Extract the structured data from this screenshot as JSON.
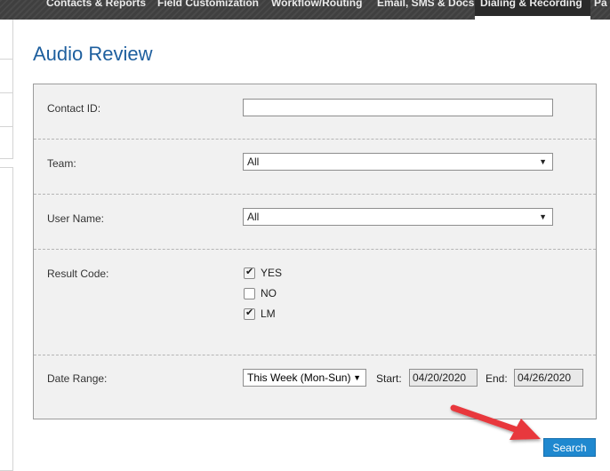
{
  "nav": {
    "tabs": [
      {
        "label": "Contacts & Reports"
      },
      {
        "label": "Field Customization"
      },
      {
        "label": "Workflow/Routing"
      },
      {
        "label": "Email, SMS & Docs"
      },
      {
        "label": "Dialing & Recording"
      },
      {
        "label": "Pa"
      }
    ],
    "active_tab": "Dialing & Recording"
  },
  "page": {
    "title": "Audio Review"
  },
  "form": {
    "contact_id": {
      "label": "Contact ID:",
      "value": ""
    },
    "team": {
      "label": "Team:",
      "value": "All"
    },
    "user_name": {
      "label": "User Name:",
      "value": "All"
    },
    "result_code": {
      "label": "Result Code:",
      "options": [
        {
          "label": "YES",
          "checked": true
        },
        {
          "label": "NO",
          "checked": false
        },
        {
          "label": "LM",
          "checked": true
        }
      ]
    },
    "date_range": {
      "label": "Date Range:",
      "period": "This Week (Mon-Sun)",
      "start_label": "Start:",
      "start_value": "04/20/2020",
      "end_label": "End:",
      "end_value": "04/26/2020"
    },
    "search_label": "Search"
  },
  "colors": {
    "title": "#1e5f9e",
    "nav_bg": "#3f3f3f",
    "panel_bg": "#f1f1f1",
    "button_bg": "#1f88cf",
    "annotation_arrow": "#e8383d"
  },
  "icons": {
    "checkbox_tick": "check-icon",
    "dropdown": "caret-down-icon",
    "annotation": "red-arrow-icon"
  }
}
